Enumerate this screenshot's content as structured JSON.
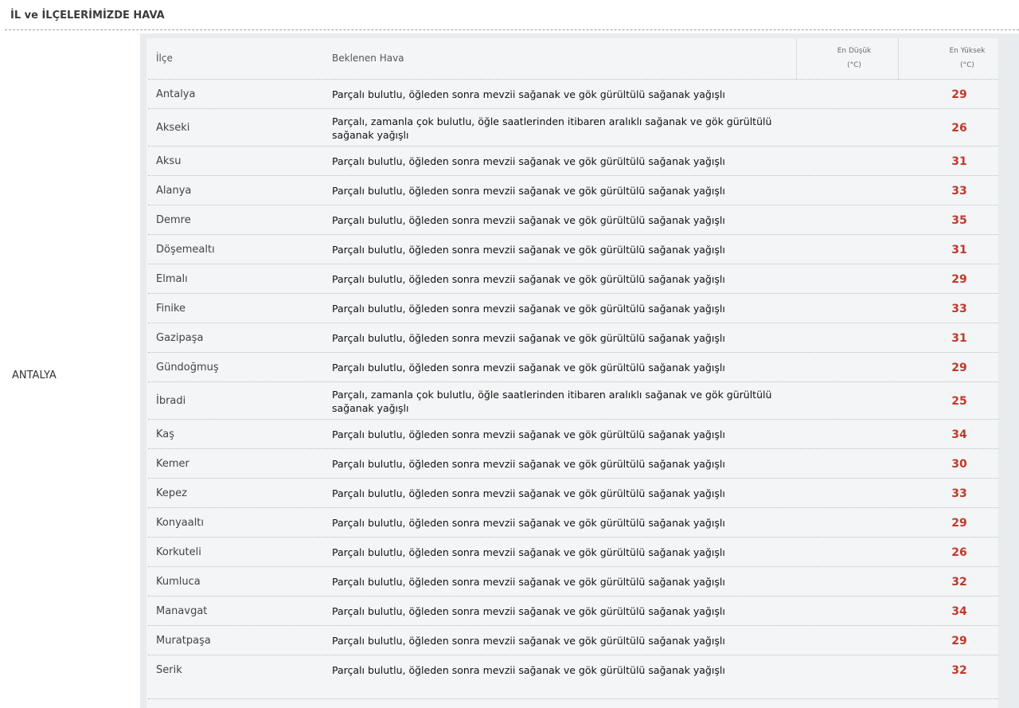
{
  "title": "İL ve İLÇELERİMİZDE HAVA",
  "city": "ANTALYA",
  "header": {
    "district": "İlçe",
    "weather": "Beklenen Hava",
    "low_line1": "En Düşük",
    "low_line2": "(°C)",
    "high_line1": "En Yüksek",
    "high_line2": "(°C)"
  },
  "rows": [
    {
      "district": "Antalya",
      "weather": "Parçalı bulutlu, öğleden sonra mevzii sağanak ve gök gürültülü sağanak yağışlı",
      "low": "",
      "high": "29"
    },
    {
      "district": "Akseki",
      "weather": "Parçalı, zamanla çok bulutlu, öğle saatlerinden itibaren aralıklı sağanak ve gök gürültülü sağanak yağışlı",
      "low": "",
      "high": "26"
    },
    {
      "district": "Aksu",
      "weather": "Parçalı bulutlu, öğleden sonra mevzii sağanak ve gök gürültülü sağanak yağışlı",
      "low": "",
      "high": "31"
    },
    {
      "district": "Alanya",
      "weather": "Parçalı bulutlu, öğleden sonra mevzii sağanak ve gök gürültülü sağanak yağışlı",
      "low": "",
      "high": "33"
    },
    {
      "district": "Demre",
      "weather": "Parçalı bulutlu, öğleden sonra mevzii sağanak ve gök gürültülü sağanak yağışlı",
      "low": "",
      "high": "35"
    },
    {
      "district": "Döşemealtı",
      "weather": "Parçalı bulutlu, öğleden sonra mevzii sağanak ve gök gürültülü sağanak yağışlı",
      "low": "",
      "high": "31"
    },
    {
      "district": "Elmalı",
      "weather": "Parçalı bulutlu, öğleden sonra mevzii sağanak ve gök gürültülü sağanak yağışlı",
      "low": "",
      "high": "29"
    },
    {
      "district": "Finike",
      "weather": "Parçalı bulutlu, öğleden sonra mevzii sağanak ve gök gürültülü sağanak yağışlı",
      "low": "",
      "high": "33"
    },
    {
      "district": "Gazipaşa",
      "weather": "Parçalı bulutlu, öğleden sonra mevzii sağanak ve gök gürültülü sağanak yağışlı",
      "low": "",
      "high": "31"
    },
    {
      "district": "Gündoğmuş",
      "weather": "Parçalı bulutlu, öğleden sonra mevzii sağanak ve gök gürültülü sağanak yağışlı",
      "low": "",
      "high": "29"
    },
    {
      "district": "İbradi",
      "weather": "Parçalı, zamanla çok bulutlu, öğle saatlerinden itibaren aralıklı sağanak ve gök gürültülü sağanak yağışlı",
      "low": "",
      "high": "25"
    },
    {
      "district": "Kaş",
      "weather": "Parçalı bulutlu, öğleden sonra mevzii sağanak ve gök gürültülü sağanak yağışlı",
      "low": "",
      "high": "34"
    },
    {
      "district": "Kemer",
      "weather": "Parçalı bulutlu, öğleden sonra mevzii sağanak ve gök gürültülü sağanak yağışlı",
      "low": "",
      "high": "30"
    },
    {
      "district": "Kepez",
      "weather": "Parçalı bulutlu, öğleden sonra mevzii sağanak ve gök gürültülü sağanak yağışlı",
      "low": "",
      "high": "33"
    },
    {
      "district": "Konyaaltı",
      "weather": "Parçalı bulutlu, öğleden sonra mevzii sağanak ve gök gürültülü sağanak yağışlı",
      "low": "",
      "high": "29"
    },
    {
      "district": "Korkuteli",
      "weather": "Parçalı bulutlu, öğleden sonra mevzii sağanak ve gök gürültülü sağanak yağışlı",
      "low": "",
      "high": "26"
    },
    {
      "district": "Kumluca",
      "weather": "Parçalı bulutlu, öğleden sonra mevzii sağanak ve gök gürültülü sağanak yağışlı",
      "low": "",
      "high": "32"
    },
    {
      "district": "Manavgat",
      "weather": "Parçalı bulutlu, öğleden sonra mevzii sağanak ve gök gürültülü sağanak yağışlı",
      "low": "",
      "high": "34"
    },
    {
      "district": "Muratpaşa",
      "weather": "Parçalı bulutlu, öğleden sonra mevzii sağanak ve gök gürültülü sağanak yağışlı",
      "low": "",
      "high": "29"
    },
    {
      "district": "Serik",
      "weather": "Parçalı bulutlu, öğleden sonra mevzii sağanak ve gök gürültülü sağanak yağışlı",
      "low": "",
      "high": "32"
    }
  ],
  "colors": {
    "high_temp": "#c0392b",
    "panel_bg": "#f3f5f6",
    "frame_bg": "#e9ecee"
  }
}
